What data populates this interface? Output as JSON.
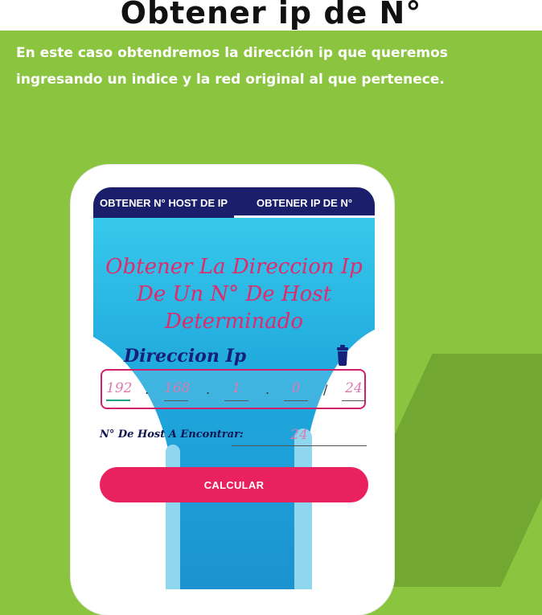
{
  "page": {
    "title": "Obtener ip de N°",
    "intro": "En este caso obtendremos la dirección ip que queremos ingresando un indice y la red original al que pertenece."
  },
  "app": {
    "tabs": [
      {
        "label": "OBTENER N° HOST DE IP",
        "active": false
      },
      {
        "label": "OBTENER IP DE N°",
        "active": true
      }
    ],
    "heading": "Obtener La Direccion Ip De Un N° De Host Determinado",
    "ip_label": "Direccion Ip",
    "ip": {
      "octet1": "192",
      "octet2": "168",
      "octet3": "1",
      "octet4": "0",
      "prefix": "24",
      "dot": ".",
      "slash": "/"
    },
    "host_label": "N° De Host A Encontrar:",
    "host_value": "24",
    "calc_button": "CALCULAR",
    "icons": {
      "clear": "trash-icon"
    },
    "colors": {
      "background": "#8bc53f",
      "tabbar": "#1b1f6b",
      "accent": "#e9215f",
      "heading": "#e02a6b",
      "label": "#16207a"
    }
  }
}
